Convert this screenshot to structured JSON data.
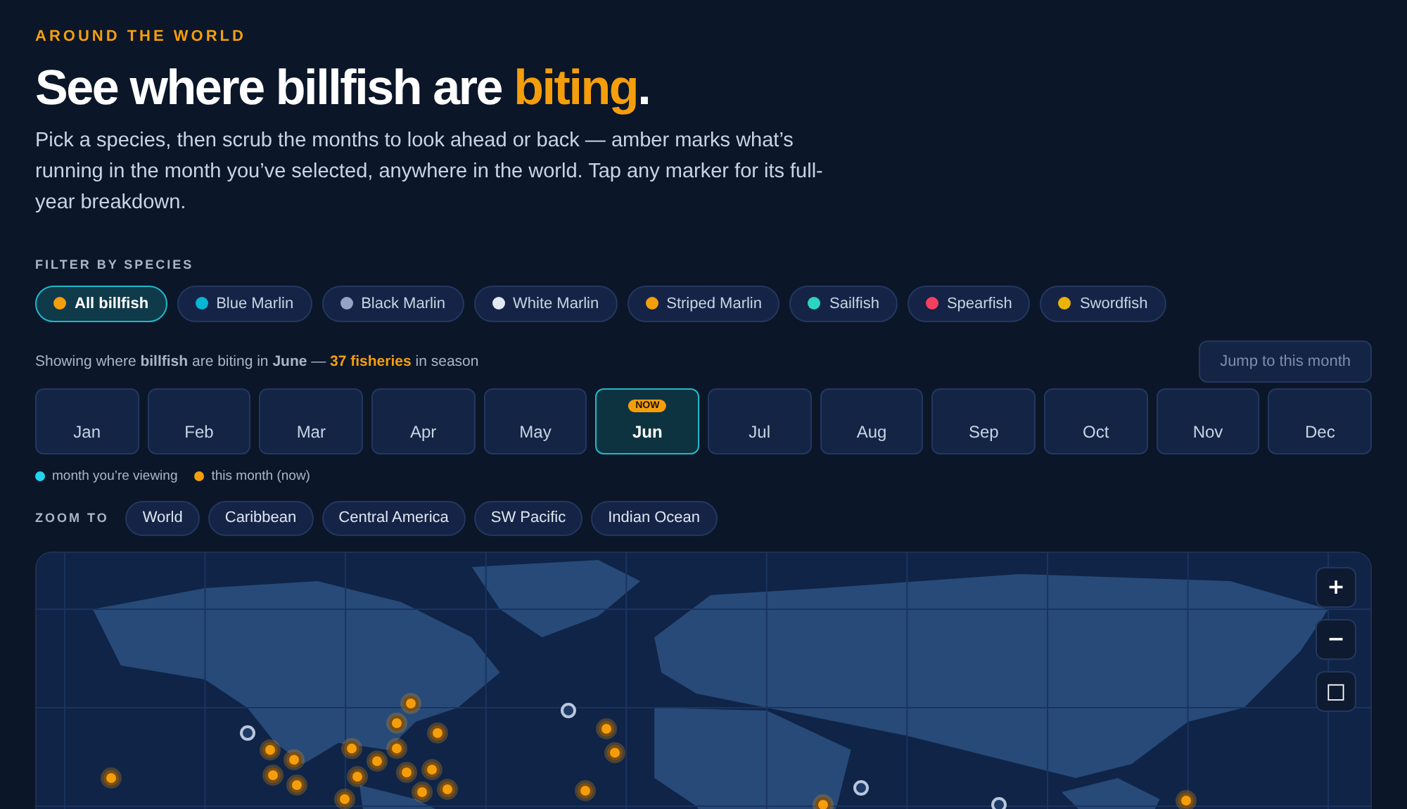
{
  "eyebrow": "AROUND THE WORLD",
  "heading": {
    "text": "See where billfish are ",
    "accent": "biting",
    "end": "."
  },
  "intro": "Pick a species, then scrub the months to look ahead or back — amber marks what’s running in the month you’ve selected, anywhere in the world. Tap any marker for its full-year breakdown.",
  "species_filter": {
    "label": "FILTER BY SPECIES",
    "chips": [
      {
        "label": "All billfish",
        "color": "#f59e0b",
        "selected": true
      },
      {
        "label": "Blue Marlin",
        "color": "#06b6d4",
        "selected": false
      },
      {
        "label": "Black Marlin",
        "color": "#94a3c8",
        "selected": false
      },
      {
        "label": "White Marlin",
        "color": "#e2e8f0",
        "selected": false
      },
      {
        "label": "Striped Marlin",
        "color": "#f59e0b",
        "selected": false
      },
      {
        "label": "Sailfish",
        "color": "#2dd4bf",
        "selected": false
      },
      {
        "label": "Spearfish",
        "color": "#f43f5e",
        "selected": false
      },
      {
        "label": "Swordfish",
        "color": "#eab308",
        "selected": false
      }
    ]
  },
  "status": {
    "text": "Showing where **billfish** are biting in **June** —",
    "accent": "37 fisheries",
    "end": "in season"
  },
  "jump_button": {
    "label": "Jump to this month",
    "disabled": true
  },
  "months": [
    {
      "label": "Jan",
      "selected": false
    },
    {
      "label": "Feb",
      "selected": false
    },
    {
      "label": "Mar",
      "selected": false
    },
    {
      "label": "Apr",
      "selected": false
    },
    {
      "label": "May",
      "selected": false
    },
    {
      "label": "Jun",
      "selected": true,
      "badge": "NOW"
    },
    {
      "label": "Jul",
      "selected": false
    },
    {
      "label": "Aug",
      "selected": false
    },
    {
      "label": "Sep",
      "selected": false
    },
    {
      "label": "Oct",
      "selected": false
    },
    {
      "label": "Nov",
      "selected": false
    },
    {
      "label": "Dec",
      "selected": false
    }
  ],
  "legend": [
    {
      "label": "month you’re viewing",
      "color": "#22d3ee"
    },
    {
      "label": "this month (now)",
      "color": "#f59e0b"
    }
  ],
  "zoom_to": {
    "label": "ZOOM TO",
    "regions": [
      "World",
      "Caribbean",
      "Central America",
      "SW Pacific",
      "Indian Ocean"
    ]
  },
  "map": {
    "kind": "picture",
    "controls": [
      "+",
      "−",
      "□"
    ],
    "markers": [
      {
        "in_season": true
      },
      {
        "in_season": true
      },
      {
        "in_season": true
      },
      {
        "in_season": true
      },
      {
        "in_season": true
      },
      {
        "in_season": true
      },
      {
        "in_season": true
      },
      {
        "in_season": true
      },
      {
        "in_season": true
      },
      {
        "in_season": true
      },
      {
        "in_season": true
      },
      {
        "in_season": true
      },
      {
        "in_season": true
      },
      {
        "in_season": true
      },
      {
        "in_season": true
      },
      {
        "in_season": true
      },
      {
        "in_season": true
      },
      {
        "in_season": true
      },
      {
        "in_season": true
      },
      {
        "in_season": true
      },
      {
        "in_season": true
      },
      {
        "in_season": true
      },
      {
        "in_season": false
      },
      {
        "in_season": false
      },
      {
        "in_season": false
      },
      {
        "in_season": false
      }
    ]
  }
}
